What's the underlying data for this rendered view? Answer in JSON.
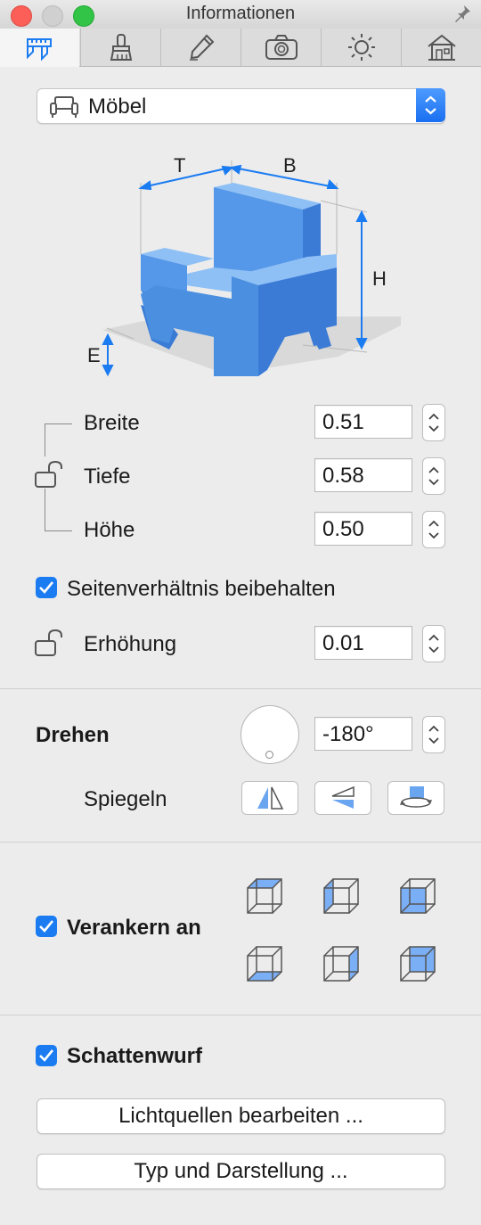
{
  "window": {
    "title": "Informationen"
  },
  "tabs": [
    {
      "icon": "caliper-icon"
    },
    {
      "icon": "brush-icon"
    },
    {
      "icon": "pencil-icon"
    },
    {
      "icon": "camera-icon"
    },
    {
      "icon": "sun-icon"
    },
    {
      "icon": "house-icon"
    }
  ],
  "category": {
    "label": "Möbel"
  },
  "figure": {
    "t_label": "T",
    "b_label": "B",
    "h_label": "H",
    "e_label": "E"
  },
  "dimensions": {
    "width": {
      "label": "Breite",
      "value": "0.51"
    },
    "depth": {
      "label": "Tiefe",
      "value": "0.58"
    },
    "height": {
      "label": "Höhe",
      "value": "0.50"
    }
  },
  "aspect": {
    "label": "Seitenverhältnis beibehalten",
    "checked": true
  },
  "elevation": {
    "label": "Erhöhung",
    "value": "0.01"
  },
  "rotate": {
    "label": "Drehen",
    "value": "-180°"
  },
  "mirror": {
    "label": "Spiegeln"
  },
  "anchor": {
    "label": "Verankern an",
    "checked": true
  },
  "shadow": {
    "label": "Schattenwurf",
    "checked": true
  },
  "buttons": {
    "light_sources": "Lichtquellen bearbeiten ...",
    "type_display": "Typ und Darstellung ..."
  },
  "colors": {
    "accent": "#1b7cf2",
    "chair": "#4a8fe0"
  }
}
